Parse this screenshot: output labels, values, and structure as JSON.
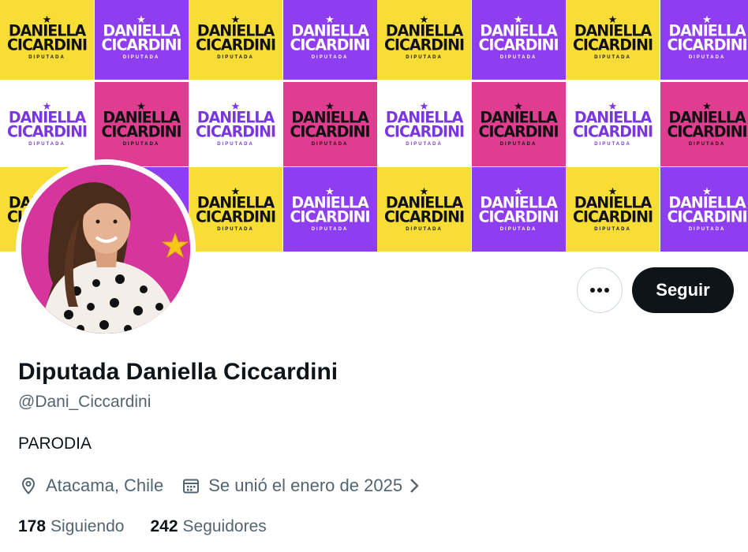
{
  "banner": {
    "tile_line1": "DANIELLA",
    "tile_line2": "CICARDINI",
    "tile_sub": "DIPUTADA",
    "colors": {
      "yellow": "#f7dd35",
      "purple": "#8f3df0",
      "white": "#ffffff",
      "pink": "#df3d8f",
      "ink_dark": "#111111",
      "ink_light": "#ffffff",
      "ink_purple": "#7a37e0"
    }
  },
  "profile": {
    "display_name": "Diputada Daniella Ciccardini",
    "handle": "@Dani_Ciccardini",
    "bio": "PARODIA",
    "location": "Atacama, Chile",
    "location_icon": "location-pin-icon",
    "joined": "Se unió el enero de 2025",
    "joined_icon": "calendar-icon",
    "following_count": "178",
    "following_label": "Siguiendo",
    "followers_count": "242",
    "followers_label": "Seguidores"
  },
  "actions": {
    "more_icon": "more-dots-icon",
    "follow_label": "Seguir"
  },
  "theme": {
    "text_primary": "#0f1419",
    "text_secondary": "#536471",
    "button_dark": "#0f1419",
    "avatar_bg": "#d6359e",
    "badge_star": "#f5c518"
  }
}
